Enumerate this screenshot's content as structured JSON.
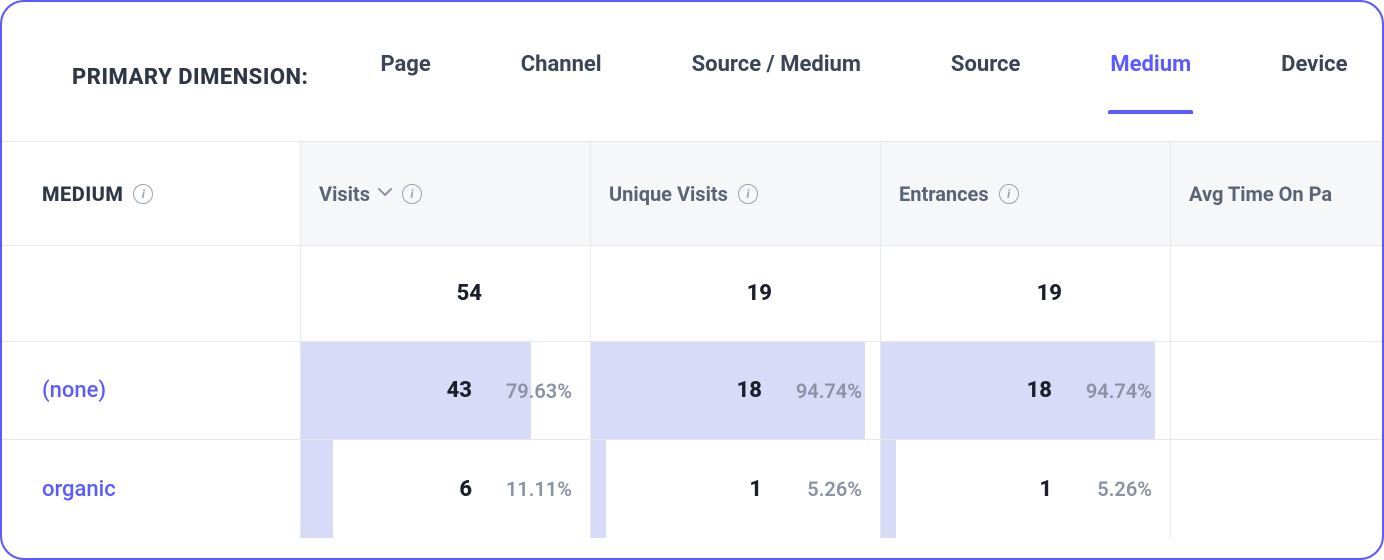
{
  "header": {
    "dimension_label": "PRIMARY DIMENSION:",
    "tabs": [
      {
        "label": "Page",
        "active": false
      },
      {
        "label": "Channel",
        "active": false
      },
      {
        "label": "Source / Medium",
        "active": false
      },
      {
        "label": "Source",
        "active": false
      },
      {
        "label": "Medium",
        "active": true
      },
      {
        "label": "Device",
        "active": false
      }
    ]
  },
  "columns": {
    "dimension": "MEDIUM",
    "metrics": [
      {
        "label": "Visits",
        "sorted": true
      },
      {
        "label": "Unique Visits",
        "sorted": false
      },
      {
        "label": "Entrances",
        "sorted": false
      }
    ],
    "overflow": "Avg Time On Pa"
  },
  "totals": {
    "visits": "54",
    "unique_visits": "19",
    "entrances": "19"
  },
  "rows": [
    {
      "label": "(none)",
      "metrics": [
        {
          "value": "43",
          "pct": "79.63%",
          "bar": 79.63
        },
        {
          "value": "18",
          "pct": "94.74%",
          "bar": 94.74
        },
        {
          "value": "18",
          "pct": "94.74%",
          "bar": 94.74
        }
      ]
    },
    {
      "label": "organic",
      "metrics": [
        {
          "value": "6",
          "pct": "11.11%",
          "bar": 11.11
        },
        {
          "value": "1",
          "pct": "5.26%",
          "bar": 5.26
        },
        {
          "value": "1",
          "pct": "5.26%",
          "bar": 5.26
        }
      ]
    }
  ]
}
